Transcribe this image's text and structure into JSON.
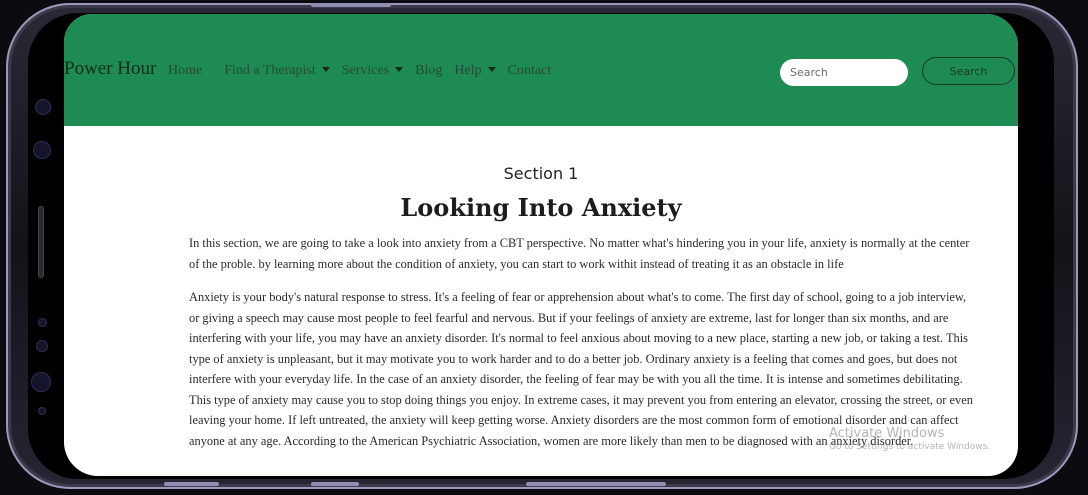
{
  "navbar": {
    "brand": "Power Hour",
    "links": [
      "Home",
      "Find a Therapist",
      "Services",
      "Blog",
      "Help",
      "Contact"
    ],
    "search_placeholder": "Search",
    "search_button": "Search",
    "colors": {
      "background": "#1d8b52"
    }
  },
  "main": {
    "section_label": "Section 1",
    "title": "Looking Into Anxiety",
    "paragraphs": [
      "In this section, we are going to take a look into anxiety from a CBT perspective. No matter what's hindering you in your life, anxiety is normally at the center of the proble. by learning more about the condition of anxiety, you can start to work withit instead of treating it as an obstacle in life",
      "Anxiety is your body's natural response to stress. It's a feeling of fear or apprehension about what's to come. The first day of school, going to a job interview, or giving a speech may cause most people to feel fearful and nervous. But if your feelings of anxiety are extreme, last for longer than six months, and are interfering with your life, you may have an anxiety disorder. It's normal to feel anxious about moving to a new place, starting a new job, or taking a test. This type of anxiety is unpleasant, but it may motivate you to work harder and to do a better job. Ordinary anxiety is a feeling that comes and goes, but does not interfere with your everyday life. In the case of an anxiety disorder, the feeling of fear may be with you all the time. It is intense and sometimes debilitating. This type of anxiety may cause you to stop doing things you enjoy. In extreme cases, it may prevent you from entering an elevator, crossing the street, or even leaving your home. If left untreated, the anxiety will keep getting worse. Anxiety disorders are the most common form of emotional disorder and can affect anyone at any age. According to the American Psychiatric Association, women are more likely than men to be diagnosed with an anxiety disorder."
    ]
  },
  "watermark": {
    "title": "Activate Windows",
    "subtitle": "Go to Settings to activate Windows."
  }
}
